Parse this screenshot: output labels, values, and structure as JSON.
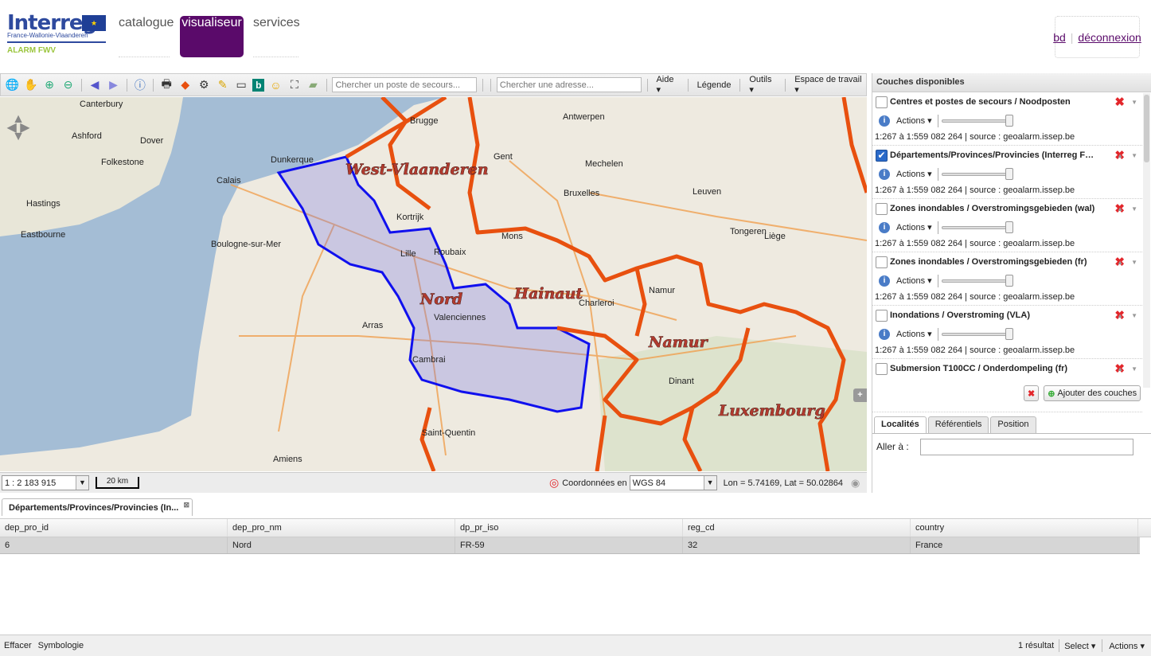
{
  "header": {
    "logo_text": "Interreg",
    "logo_sub": "France-Wallonie-Vlaanderen",
    "logo_project": "ALARM FWV",
    "nav": [
      {
        "label": "catalogue",
        "active": false
      },
      {
        "label": "visualiseur",
        "active": true
      },
      {
        "label": "services",
        "active": false
      }
    ],
    "user": "bd",
    "logout": "déconnexion"
  },
  "toolbar": {
    "icons": [
      "zoom-extent-icon",
      "pan-icon",
      "zoom-in-icon",
      "zoom-out-icon",
      "previous-icon",
      "next-icon",
      "info-icon",
      "print-icon",
      "warning-sign-icon",
      "settings-icon",
      "pencil-icon",
      "measure-icon",
      "bing-icon",
      "streetview-icon",
      "fullscreen-icon",
      "map-icon"
    ],
    "search_rescue_placeholder": "Chercher un poste de secours...",
    "search_address_placeholder": "Chercher une adresse...",
    "menus": [
      "Aide",
      "Légende",
      "Outils",
      "Espace de travail"
    ]
  },
  "map": {
    "labels": [
      "West-Vlaanderen",
      "Nord",
      "Hainaut",
      "Namur",
      "Luxembourg"
    ],
    "places": [
      "Canterbury",
      "Brugge",
      "Antwerpen",
      "Dunkerque",
      "Calais",
      "Gent",
      "Bruxelles",
      "Lille",
      "Roubaix",
      "Charleroi",
      "Namur",
      "Amiens",
      "Boulogne-sur-Mer",
      "Valenciennes",
      "Mons",
      "Liège",
      "Cambrai",
      "Arras",
      "Saint-Quentin",
      "Ashford",
      "Dover",
      "Folkestone",
      "Hastings",
      "Eastbourne",
      "Kortrijk",
      "Mechelen",
      "Leuven",
      "Tongeren",
      "Dinant"
    ],
    "scale": "1 : 2 183 915",
    "scalebar": "20 km",
    "coord_label": "Coordonnées en",
    "crs": "WGS 84",
    "coords": "Lon = 5.74169, Lat = 50.02864",
    "colors": {
      "border": "#e8500f",
      "region": "#1010ee",
      "sea": "#a4bdd5"
    }
  },
  "panel": {
    "title": "Couches disponibles",
    "layers": [
      {
        "name": "Centres et postes de secours / Noodposten",
        "checked": false,
        "actions": "Actions",
        "scale": "1:267 à 1:559 082 264  |  source : geoalarm.issep.be"
      },
      {
        "name": "Départements/Provinces/Provincies (Interreg FWV)",
        "checked": true,
        "actions": "Actions",
        "scale": "1:267 à 1:559 082 264  |  source : geoalarm.issep.be"
      },
      {
        "name": "Zones inondables / Overstromingsgebieden (wal)",
        "checked": false,
        "actions": "Actions",
        "scale": "1:267 à 1:559 082 264  |  source : geoalarm.issep.be"
      },
      {
        "name": "Zones inondables / Overstromingsgebieden (fr)",
        "checked": false,
        "actions": "Actions",
        "scale": "1:267 à 1:559 082 264  |  source : geoalarm.issep.be"
      },
      {
        "name": "Inondations / Overstroming (VLA)",
        "checked": false,
        "actions": "Actions",
        "scale": "1:267 à 1:559 082 264  |  source : geoalarm.issep.be"
      },
      {
        "name": "Submersion T100CC / Onderdompeling (fr)",
        "checked": false,
        "actions": "",
        "scale": ""
      }
    ],
    "add_label": "Ajouter des couches",
    "tabs": [
      "Localités",
      "Référentiels",
      "Position"
    ],
    "goto_label": "Aller à :"
  },
  "grid": {
    "tab": "Départements/Provinces/Provincies (In...",
    "columns": [
      "dep_pro_id",
      "dep_pro_nm",
      "dp_pr_iso",
      "reg_cd",
      "country"
    ],
    "rows": [
      [
        "6",
        "Nord",
        "FR-59",
        "32",
        "France"
      ]
    ]
  },
  "footer": {
    "clear": "Effacer",
    "symbology": "Symbologie",
    "count": "1 résultat",
    "select": "Select",
    "actions": "Actions"
  }
}
